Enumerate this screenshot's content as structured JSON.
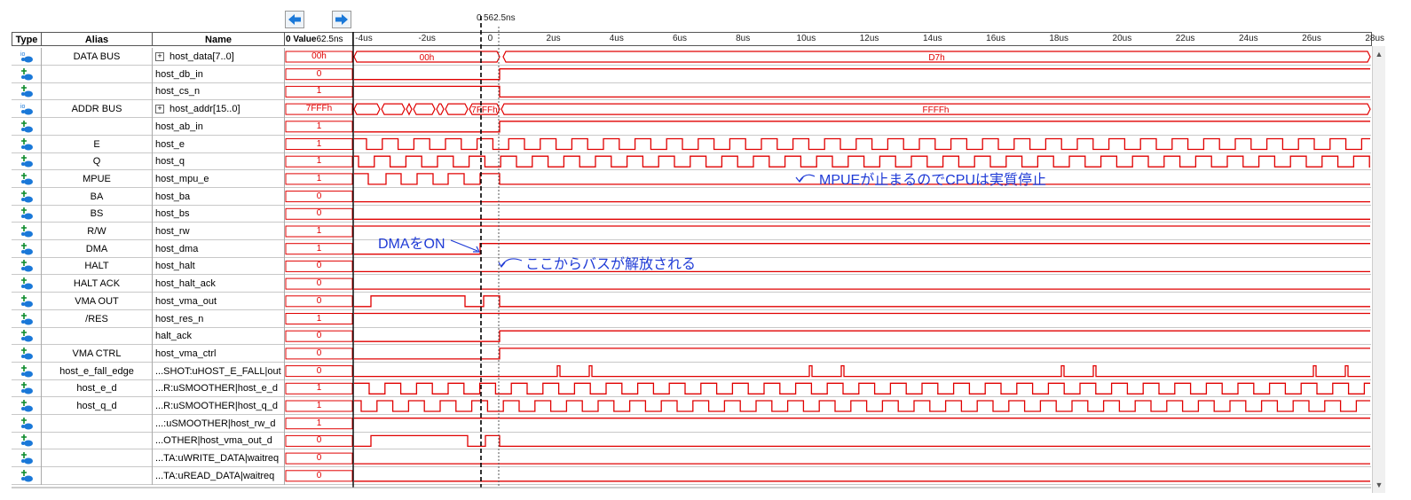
{
  "toolbar": {
    "nav_left_icon": "arrow-left-icon",
    "nav_right_icon": "arrow-right-icon",
    "cursor_time_label": "562.5ns",
    "cursor_zero": "0"
  },
  "columns": {
    "type": "Type",
    "alias": "Alias",
    "name": "Name",
    "value": "Value",
    "value_prefix": "0",
    "value_time": "62.5ns"
  },
  "axis": {
    "ticks": [
      "-4us",
      "-2us",
      "0",
      "2us",
      "4us",
      "6us",
      "8us",
      "10us",
      "12us",
      "14us",
      "16us",
      "18us",
      "20us",
      "22us",
      "24us",
      "26us",
      "28us"
    ]
  },
  "signals": [
    {
      "type": "io",
      "alias": "DATA BUS",
      "name": "host_data[7..0]",
      "expand": true,
      "value": "00h",
      "bus_labels": [
        "00h",
        "D7h"
      ]
    },
    {
      "type": "in",
      "alias": "",
      "name": "host_db_in",
      "value": "0"
    },
    {
      "type": "in",
      "alias": "",
      "name": "host_cs_n",
      "value": "1"
    },
    {
      "type": "io",
      "alias": "ADDR BUS",
      "name": "host_addr[15..0]",
      "expand": true,
      "value": "7FFFh",
      "bus_labels": [
        "7FFFh",
        "FFFFh"
      ]
    },
    {
      "type": "in",
      "alias": "",
      "name": "host_ab_in",
      "value": "1"
    },
    {
      "type": "in",
      "alias": "E",
      "name": "host_e",
      "value": "1"
    },
    {
      "type": "in",
      "alias": "Q",
      "name": "host_q",
      "value": "1"
    },
    {
      "type": "in",
      "alias": "MPUE",
      "name": "host_mpu_e",
      "value": "1"
    },
    {
      "type": "in",
      "alias": "BA",
      "name": "host_ba",
      "value": "0"
    },
    {
      "type": "in",
      "alias": "BS",
      "name": "host_bs",
      "value": "0"
    },
    {
      "type": "in",
      "alias": "R/W",
      "name": "host_rw",
      "value": "1"
    },
    {
      "type": "in",
      "alias": "DMA",
      "name": "host_dma",
      "value": "1"
    },
    {
      "type": "in",
      "alias": "HALT",
      "name": "host_halt",
      "value": "0"
    },
    {
      "type": "in",
      "alias": "HALT ACK",
      "name": "host_halt_ack",
      "value": "0"
    },
    {
      "type": "in",
      "alias": "VMA OUT",
      "name": "host_vma_out",
      "value": "0"
    },
    {
      "type": "in",
      "alias": "/RES",
      "name": "host_res_n",
      "value": "1"
    },
    {
      "type": "in",
      "alias": "",
      "name": "halt_ack",
      "value": "0"
    },
    {
      "type": "in",
      "alias": "VMA CTRL",
      "name": "host_vma_ctrl",
      "value": "0"
    },
    {
      "type": "in",
      "alias": "host_e_fall_edge",
      "name": "...SHOT:uHOST_E_FALL|out",
      "value": "0"
    },
    {
      "type": "in",
      "alias": "host_e_d",
      "name": "...R:uSMOOTHER|host_e_d",
      "value": "1"
    },
    {
      "type": "in",
      "alias": "host_q_d",
      "name": "...R:uSMOOTHER|host_q_d",
      "value": "1"
    },
    {
      "type": "in",
      "alias": "",
      "name": "...:uSMOOTHER|host_rw_d",
      "value": "1"
    },
    {
      "type": "in",
      "alias": "",
      "name": "...OTHER|host_vma_out_d",
      "value": "0"
    },
    {
      "type": "in",
      "alias": "",
      "name": "...TA:uWRITE_DATA|waitreq",
      "value": "0"
    },
    {
      "type": "in",
      "alias": "",
      "name": "...TA:uREAD_DATA|waitreq",
      "value": "0"
    }
  ],
  "annotations": {
    "mpue_note": "MPUEが止まるのでCPUは実質停止",
    "dma_note": "DMAをON",
    "bus_note": "ここからバスが解放される"
  },
  "colors": {
    "wave": "#e00000",
    "annotation": "#1f3bd6",
    "cursor": "#000000",
    "icon_blue": "#1a78d8"
  }
}
